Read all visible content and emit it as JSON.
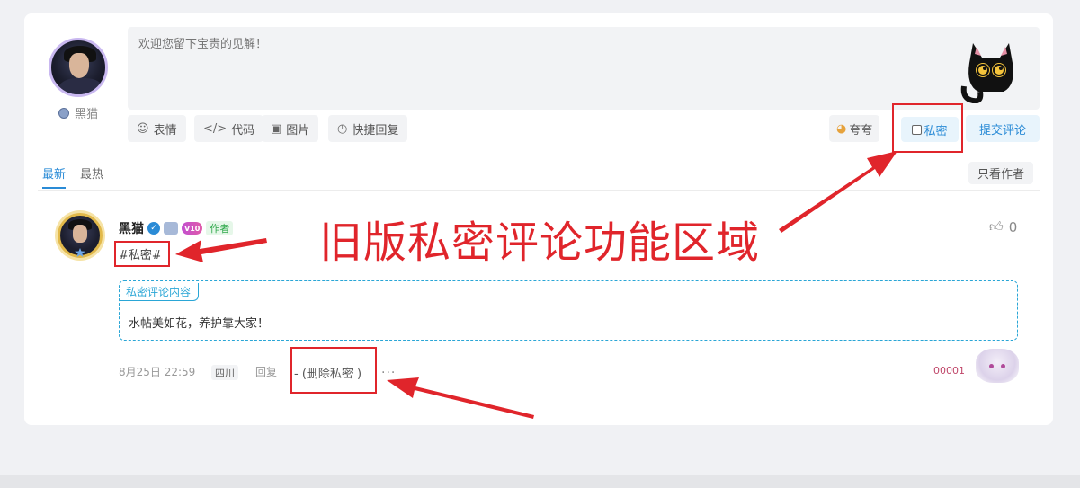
{
  "editor": {
    "user_name": "黑猫",
    "placeholder": "欢迎您留下宝贵的见解！",
    "tools": [
      {
        "icon": "smile-icon",
        "label": "表情"
      },
      {
        "icon": "code-icon",
        "label": "代码"
      },
      {
        "icon": "image-icon",
        "label": "图片"
      },
      {
        "icon": "quick-reply-icon",
        "label": "快捷回复"
      }
    ],
    "kuakua_label": "夸夸",
    "private_label": "私密",
    "submit_label": "提交评论"
  },
  "tabs": {
    "items": [
      {
        "label": "最新",
        "active": true
      },
      {
        "label": "最热",
        "active": false
      }
    ],
    "author_only_label": "只看作者"
  },
  "comment": {
    "author": "黑猫",
    "vip_label": "V10",
    "author_tag": "作者",
    "like_count": "0",
    "hash_tag": "#私密#",
    "private_label": "私密评论内容",
    "private_text": "水帖美如花，养护靠大家！",
    "date": "8月25日 22:59",
    "location": "四川",
    "reply_label": "回复",
    "remove_private": "- (删除私密 )",
    "more": "···",
    "number": "00001"
  },
  "annotation": {
    "text": "旧版私密评论功能区域",
    "color": "#e0252b"
  },
  "colors": {
    "accent": "#2a8bd6",
    "private_border": "#2aa6d6",
    "annotation_red": "#e0252b"
  }
}
